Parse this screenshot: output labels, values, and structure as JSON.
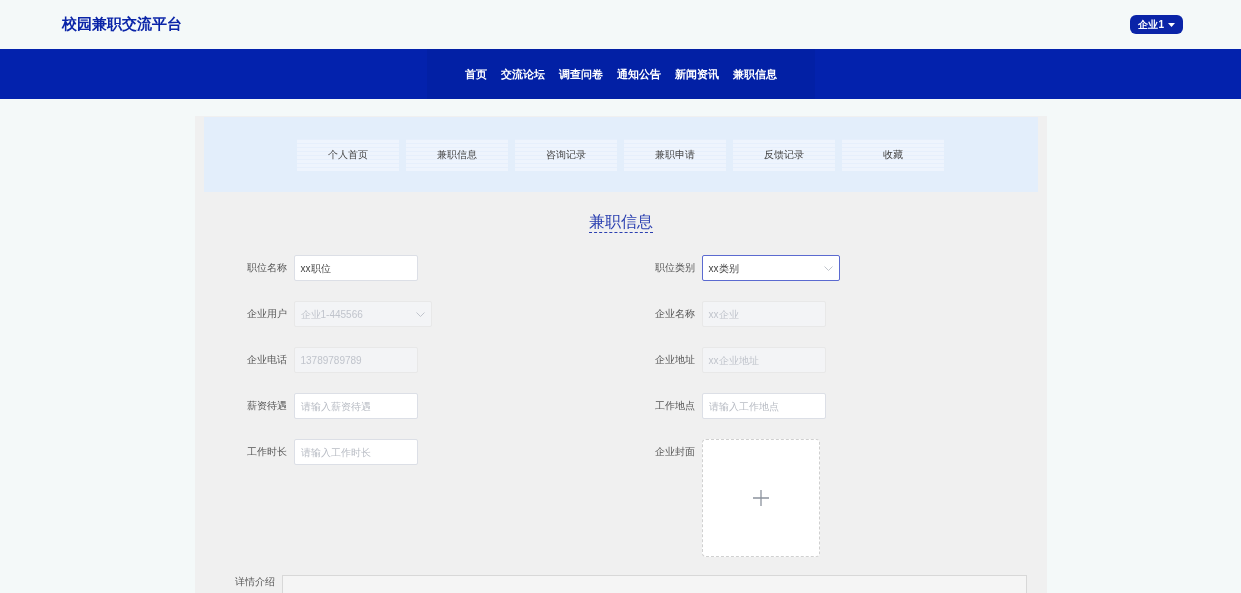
{
  "header": {
    "logo": "校园兼职交流平台",
    "user_menu": "企业1"
  },
  "nav": {
    "items": [
      "首页",
      "交流论坛",
      "调查问卷",
      "通知公告",
      "新闻资讯",
      "兼职信息"
    ]
  },
  "tabs": [
    "个人首页",
    "兼职信息",
    "咨询记录",
    "兼职申请",
    "反馈记录",
    "收藏"
  ],
  "form": {
    "title": "兼职信息",
    "left": [
      {
        "label": "职位名称",
        "kind": "input",
        "value": "xx职位",
        "disabled": false
      },
      {
        "label": "企业用户",
        "kind": "select",
        "value": "企业1-445566",
        "disabled": true
      },
      {
        "label": "企业电话",
        "kind": "input",
        "value": "13789789789",
        "disabled": true
      },
      {
        "label": "薪资待遇",
        "kind": "input",
        "placeholder": "请输入薪资待遇",
        "disabled": false
      },
      {
        "label": "工作时长",
        "kind": "input",
        "placeholder": "请输入工作时长",
        "disabled": false
      }
    ],
    "right": [
      {
        "label": "职位类别",
        "kind": "select",
        "value": "xx类别",
        "disabled": false,
        "focused": true
      },
      {
        "label": "企业名称",
        "kind": "input",
        "value": "xx企业",
        "disabled": true
      },
      {
        "label": "企业地址",
        "kind": "input",
        "value": "xx企业地址",
        "disabled": true
      },
      {
        "label": "工作地点",
        "kind": "input",
        "placeholder": "请输入工作地点",
        "disabled": false
      },
      {
        "label": "企业封面",
        "kind": "upload"
      }
    ],
    "detail_label": "详情介绍"
  }
}
